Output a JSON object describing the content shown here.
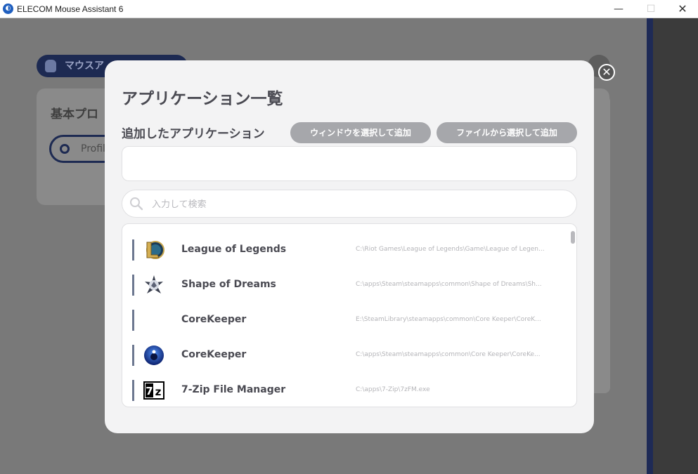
{
  "window": {
    "title": "ELECOM Mouse Assistant 6",
    "minimize_glyph": "—",
    "maximize_glyph": "☐",
    "close_glyph": "✕"
  },
  "background": {
    "tab_label": "マウスア",
    "card_title": "基本プロ",
    "profile_label": "Profil"
  },
  "modal": {
    "title": "アプリケーション一覧",
    "added_section_label": "追加したアプリケーション",
    "buttons": {
      "select_window": "ウィンドウを選択して追加",
      "select_file": "ファイルから選択して追加"
    },
    "search": {
      "placeholder": "入力して検索",
      "value": ""
    },
    "applications": [
      {
        "name": "League of Legends",
        "path": "C:\\Riot Games\\League of Legends\\Game\\League of Legen...",
        "icon": "league-of-legends-icon"
      },
      {
        "name": "Shape of Dreams",
        "path": "C:\\apps\\Steam\\steamapps\\common\\Shape of Dreams\\Sh...",
        "icon": "shape-of-dreams-icon"
      },
      {
        "name": "CoreKeeper",
        "path": "E:\\SteamLibrary\\steamapps\\common\\Core Keeper\\CoreK...",
        "icon": "none"
      },
      {
        "name": "CoreKeeper",
        "path": "C:\\apps\\Steam\\steamapps\\common\\Core Keeper\\CoreKe...",
        "icon": "core-keeper-icon"
      },
      {
        "name": "7-Zip File Manager",
        "path": "C:\\apps\\7-Zip\\7zFM.exe",
        "icon": "7zip-icon",
        "icon_text": "7z"
      }
    ]
  },
  "colors": {
    "accent_navy": "#1d2a52",
    "button_gray": "#a6a7ab",
    "row_bar": "#6d7890"
  }
}
